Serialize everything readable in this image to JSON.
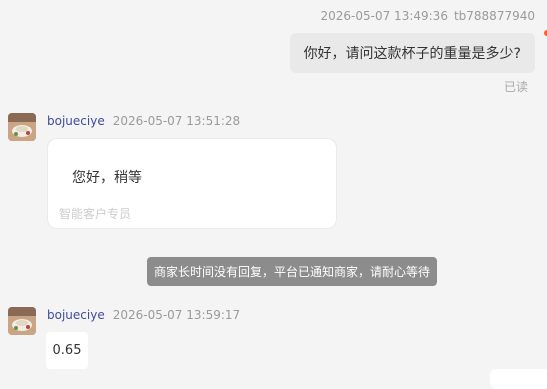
{
  "conversation": {
    "messages": [
      {
        "direction": "outgoing",
        "timestamp": "2026-05-07 13:49:36",
        "sender": "tb788877940",
        "text": "你好，请问这款杯子的重量是多少?",
        "status": "已读"
      },
      {
        "direction": "incoming",
        "sender": "bojueciye",
        "timestamp": "2026-05-07 13:51:28",
        "text": "您好，稍等",
        "role": "智能客户专员"
      },
      {
        "direction": "incoming",
        "sender": "bojueciye",
        "timestamp": "2026-05-07 13:59:17",
        "text": "0.65"
      }
    ],
    "system_notice": "商家长时间没有回复，平台已通知商家，请耐心等待"
  },
  "colors": {
    "page_background": "#f4f4f4",
    "outgoing_bubble": "#e9e9e9",
    "incoming_bubble": "#ffffff",
    "sender_name": "#3f4b9a",
    "meta_text": "#9a9a9a",
    "notice_background": "#8c8c8c",
    "unread_dot": "#ff5a3c"
  },
  "icons": {
    "avatar": "shop-avatar-icon"
  }
}
